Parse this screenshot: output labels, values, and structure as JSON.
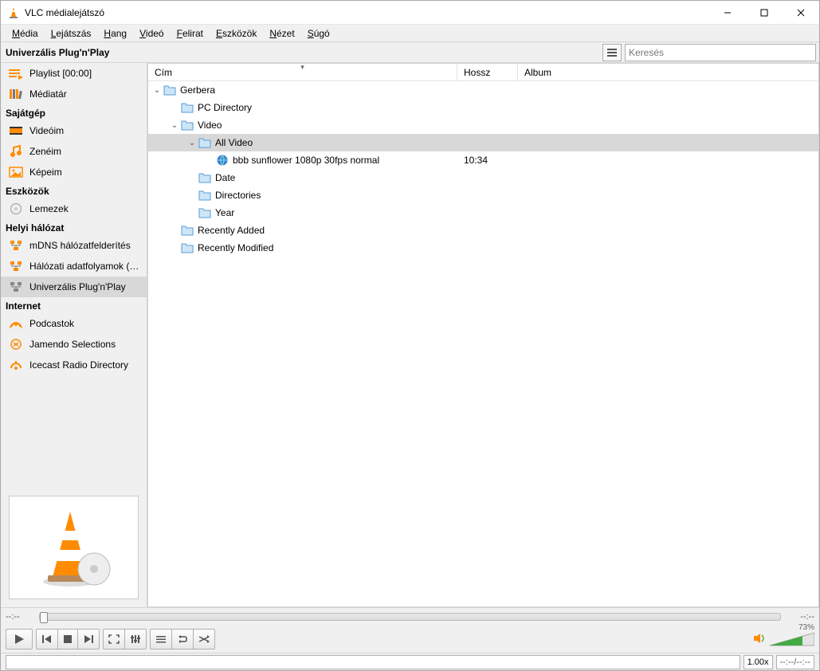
{
  "window": {
    "title": "VLC médialejátszó"
  },
  "menu": [
    "Média",
    "Lejátszás",
    "Hang",
    "Videó",
    "Felirat",
    "Eszközök",
    "Nézet",
    "Súgó"
  ],
  "toolbar": {
    "breadcrumb": "Univerzális Plug'n'Play",
    "search_placeholder": "Keresés"
  },
  "sidebar": {
    "groups": [
      {
        "items": [
          {
            "label": "Playlist [00:00]",
            "icon": "playlist"
          },
          {
            "label": "Médiatár",
            "icon": "library"
          }
        ]
      },
      {
        "header": "Sajátgép",
        "items": [
          {
            "label": "Videóim",
            "icon": "video"
          },
          {
            "label": "Zenéim",
            "icon": "music"
          },
          {
            "label": "Képeim",
            "icon": "pictures"
          }
        ]
      },
      {
        "header": "Eszközök",
        "items": [
          {
            "label": "Lemezek",
            "icon": "disc"
          }
        ]
      },
      {
        "header": "Helyi hálózat",
        "items": [
          {
            "label": "mDNS hálózatfelderítés",
            "icon": "net"
          },
          {
            "label": "Hálózati adatfolyamok (S...",
            "icon": "net"
          },
          {
            "label": "Univerzális Plug'n'Play",
            "icon": "upnp",
            "selected": true
          }
        ]
      },
      {
        "header": "Internet",
        "items": [
          {
            "label": "Podcastok",
            "icon": "podcast"
          },
          {
            "label": "Jamendo Selections",
            "icon": "jamendo"
          },
          {
            "label": "Icecast Radio Directory",
            "icon": "icecast"
          }
        ]
      }
    ]
  },
  "columns": {
    "title": "Cím",
    "length": "Hossz",
    "album": "Album"
  },
  "tree": [
    {
      "depth": 0,
      "expander": "open",
      "icon": "folder",
      "label": "Gerbera"
    },
    {
      "depth": 1,
      "expander": "",
      "icon": "folder",
      "label": "PC Directory"
    },
    {
      "depth": 1,
      "expander": "open",
      "icon": "folder",
      "label": "Video"
    },
    {
      "depth": 2,
      "expander": "open",
      "icon": "folder",
      "label": "All Video",
      "selected": true
    },
    {
      "depth": 3,
      "expander": "",
      "icon": "globe",
      "label": "bbb sunflower 1080p 30fps normal",
      "length": "10:34"
    },
    {
      "depth": 2,
      "expander": "",
      "icon": "folder",
      "label": "Date"
    },
    {
      "depth": 2,
      "expander": "",
      "icon": "folder",
      "label": "Directories"
    },
    {
      "depth": 2,
      "expander": "",
      "icon": "folder",
      "label": "Year"
    },
    {
      "depth": 1,
      "expander": "",
      "icon": "folder",
      "label": "Recently Added"
    },
    {
      "depth": 1,
      "expander": "",
      "icon": "folder",
      "label": "Recently Modified"
    }
  ],
  "seek": {
    "left": "--:--",
    "right": "--:--"
  },
  "volume": {
    "percent": "73%"
  },
  "status": {
    "speed": "1.00x",
    "time": "--:--/--:--"
  }
}
